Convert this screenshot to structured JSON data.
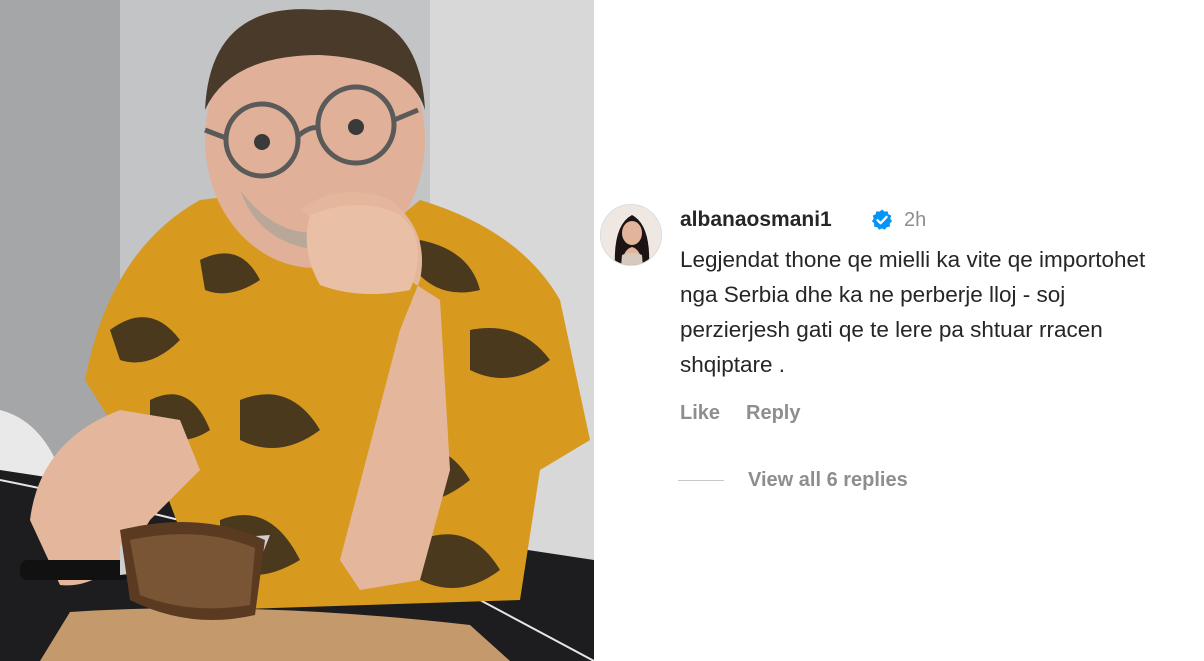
{
  "photo": {
    "description_icon": "person-photo"
  },
  "comment": {
    "username": "albanaosmani1",
    "verified_icon": "verified-badge-icon",
    "timestamp": "2h",
    "text": "Legjendat thone qe mielli ka vite qe importohet nga Serbia dhe ka ne perberje lloj - soj perzierjesh gati qe te lere pa shtuar rracen shqiptare .",
    "like_label": "Like",
    "reply_label": "Reply",
    "view_replies_label": "View all 6 replies"
  },
  "colors": {
    "verified_blue": "#0095f6",
    "text_primary": "#262626",
    "text_secondary": "#8e8e8e"
  }
}
